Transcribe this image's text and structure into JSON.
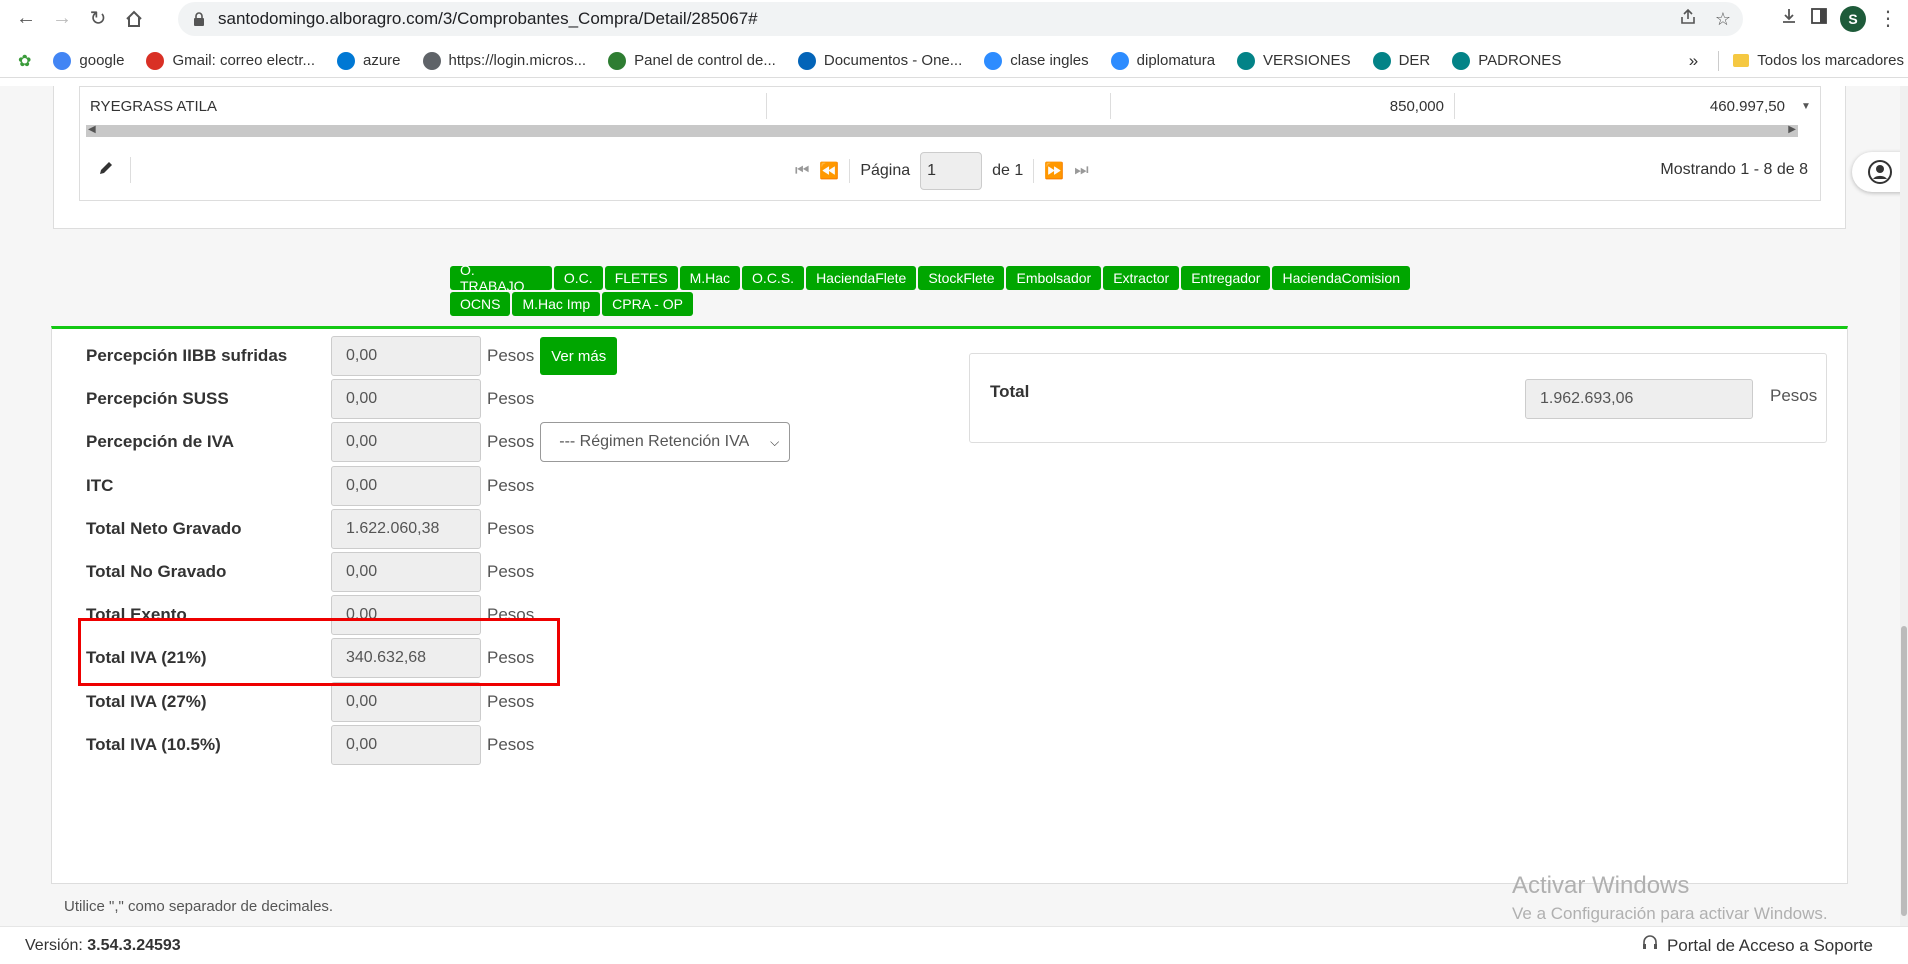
{
  "browser": {
    "url": "santodomingo.alboragro.com/3/Comprobantes_Compra/Detail/285067#",
    "profile_initial": "S"
  },
  "bookmarks": [
    {
      "label": "google",
      "icon": "google-icon",
      "color": "#4285f4"
    },
    {
      "label": "Gmail: correo electr...",
      "icon": "gmail-icon",
      "color": "#d93025"
    },
    {
      "label": "azure",
      "icon": "azure-icon",
      "color": "#0078d4"
    },
    {
      "label": "https://login.micros...",
      "icon": "globe-icon",
      "color": "#5f6368"
    },
    {
      "label": "Panel de control de...",
      "icon": "panel-icon",
      "color": "#2e7d32"
    },
    {
      "label": "Documentos - One...",
      "icon": "onedrive-icon",
      "color": "#0364b8"
    },
    {
      "label": "clase ingles",
      "icon": "zoom-icon",
      "color": "#2d8cff"
    },
    {
      "label": "diplomatura",
      "icon": "zoom-icon",
      "color": "#2d8cff"
    },
    {
      "label": "VERSIONES",
      "icon": "sharepoint-icon",
      "color": "#038387"
    },
    {
      "label": "DER",
      "icon": "sharepoint-icon",
      "color": "#038387"
    },
    {
      "label": "PADRONES",
      "icon": "sharepoint-icon",
      "color": "#038387"
    }
  ],
  "bookmarks_overflow": "»",
  "bookmarks_all": "Todos los marcadores",
  "grid": {
    "row": [
      "RYEGRASS ATILA",
      "",
      "850,000",
      "460.997,50"
    ],
    "pager": {
      "page_label": "Página",
      "page_value": "1",
      "of_label": "de 1",
      "info": "Mostrando 1 - 8 de 8"
    }
  },
  "green_buttons": {
    "row1": [
      "O. TRABAJO",
      "O.C.",
      "FLETES",
      "M.Hac",
      "O.C.S.",
      "HaciendaFlete",
      "StockFlete",
      "Embolsador",
      "Extractor",
      "Entregador",
      "HaciendaComision"
    ],
    "row2": [
      "OCNS",
      "M.Hac Imp",
      "CPRA - OP"
    ]
  },
  "fields": [
    {
      "label": "Percepción IIBB sufridas",
      "value": "0,00",
      "unit": "Pesos"
    },
    {
      "label": "Percepción SUSS",
      "value": "0,00",
      "unit": "Pesos"
    },
    {
      "label": "Percepción de IVA",
      "value": "0,00",
      "unit": "Pesos"
    },
    {
      "label": "ITC",
      "value": "0,00",
      "unit": "Pesos"
    },
    {
      "label": "Total Neto Gravado",
      "value": "1.622.060,38",
      "unit": "Pesos"
    },
    {
      "label": "Total No Gravado",
      "value": "0,00",
      "unit": "Pesos"
    },
    {
      "label": "Total Exento",
      "value": "0,00",
      "unit": "Pesos"
    },
    {
      "label": "Total IVA (21%)",
      "value": "340.632,68",
      "unit": "Pesos"
    },
    {
      "label": "Total IVA (27%)",
      "value": "0,00",
      "unit": "Pesos"
    },
    {
      "label": "Total IVA (10.5%)",
      "value": "0,00",
      "unit": "Pesos"
    }
  ],
  "ver_mas": "Ver más",
  "regimen_select": "--- Régimen Retención IVA",
  "total": {
    "label": "Total",
    "value": "1.962.693,06",
    "unit": "Pesos"
  },
  "hint": "Utilice \",\" como separador de decimales.",
  "watermark": {
    "title": "Activar Windows",
    "subtitle": "Ve a Configuración para activar Windows."
  },
  "footer": {
    "version_label": "Versión:",
    "version": "3.54.3.24593",
    "soporte": "Portal de Acceso a Soporte"
  },
  "colors": {
    "accent_green": "#00a600",
    "highlight_red": "#e00000"
  }
}
